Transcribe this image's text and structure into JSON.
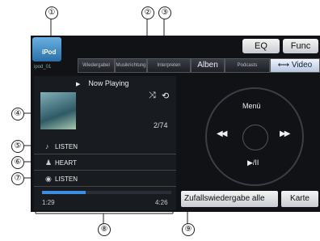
{
  "callouts": [
    "①",
    "②",
    "③",
    "④",
    "⑤",
    "⑥",
    "⑦",
    "⑧",
    "⑨"
  ],
  "source": {
    "label": "iPod",
    "sub": "ipod_01"
  },
  "header": {
    "eq_label": "EQ",
    "func_label": "Func"
  },
  "tabs": [
    {
      "label": "Wiedergabel",
      "active": false
    },
    {
      "label": "Musikrichtung",
      "active": false
    },
    {
      "label": "Interpreten",
      "active": false
    },
    {
      "label": "Alben",
      "active": false
    },
    {
      "label": "Podcasts",
      "active": false
    },
    {
      "label": "⟷ Video",
      "active": true
    }
  ],
  "now_playing": {
    "title": "Now Playing",
    "play_icon": "play-triangle-icon",
    "track_number": "2/74",
    "rows": [
      {
        "icon": "note-icon",
        "text": "LISTEN"
      },
      {
        "icon": "artist-icon",
        "text": "HEART"
      },
      {
        "icon": "album-icon",
        "text": "LISTEN"
      }
    ],
    "elapsed": "1:29",
    "total": "4:26",
    "progress": 0.34
  },
  "status_icons": {
    "shuffle": "shuffle-icon",
    "repeat": "repeat-icon"
  },
  "controls": {
    "menu_label": "Menü",
    "prev_label": "◀◀",
    "next_label": "▶▶",
    "play_pause_label": "▶/II"
  },
  "bottom_buttons": {
    "shuffle_all_label": "Zufallswiedergabe alle",
    "karte_label": "Karte"
  }
}
